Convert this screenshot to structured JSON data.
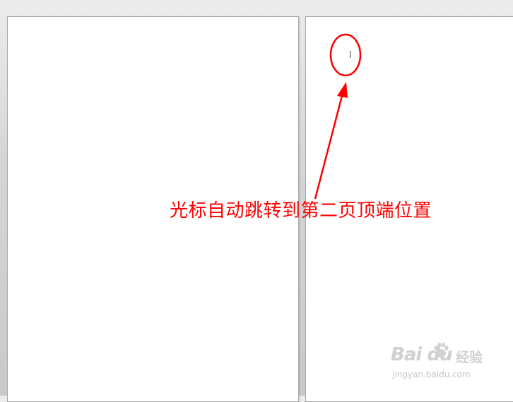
{
  "document": {
    "pages": [
      {
        "name": "page-1"
      },
      {
        "name": "page-2"
      }
    ]
  },
  "annotation": {
    "text": "光标自动跳转到第二页顶端位置",
    "color": "#ff0000"
  },
  "watermark": {
    "logo": "Bai du",
    "brand": "经验",
    "url": "jingyan.baidu.com"
  }
}
